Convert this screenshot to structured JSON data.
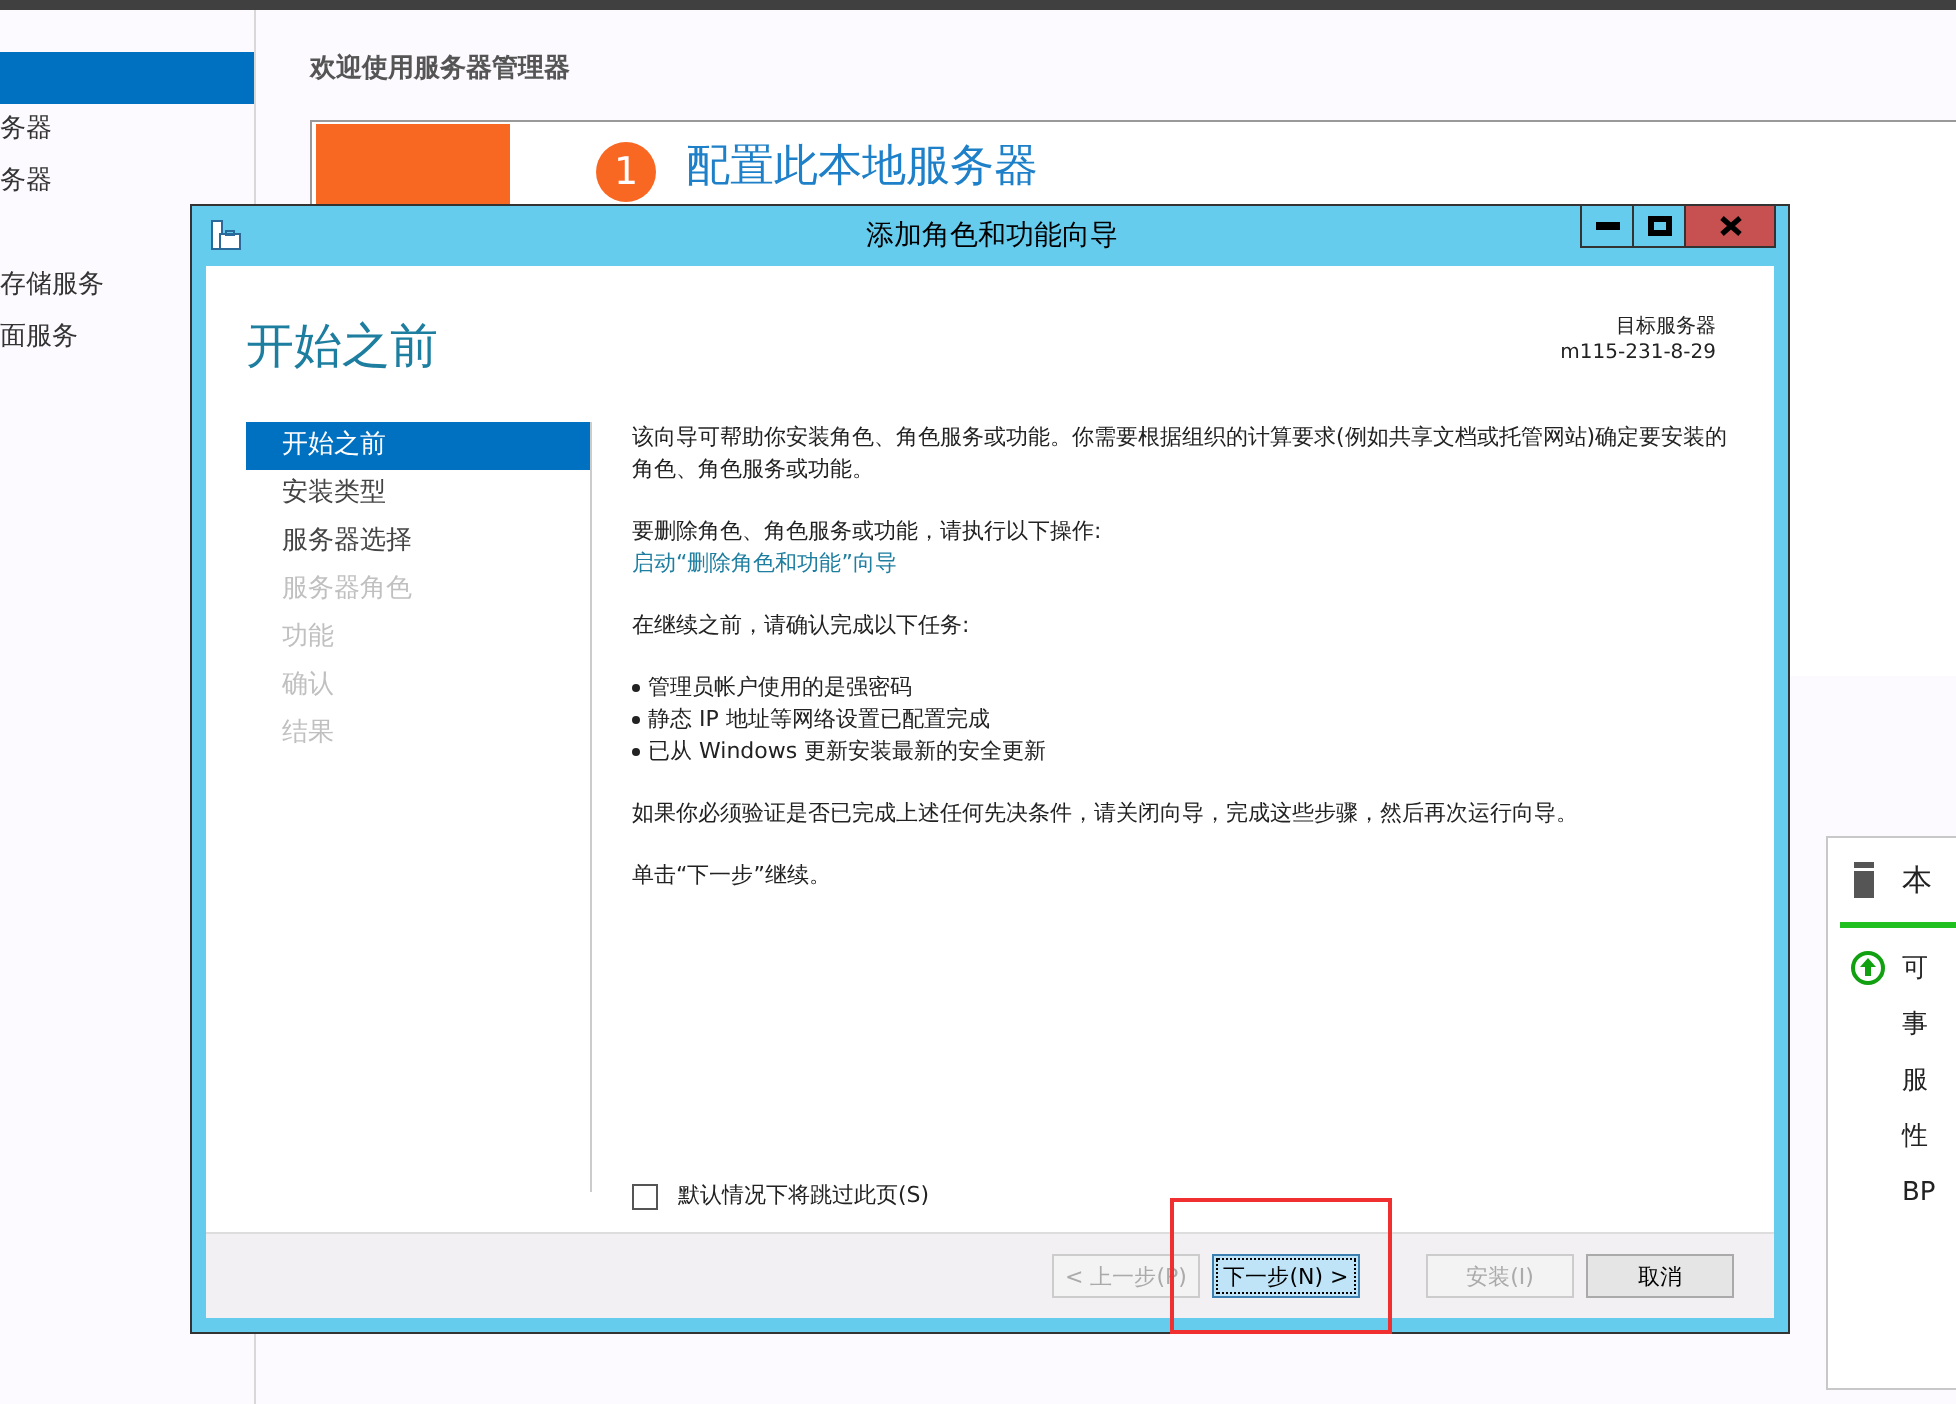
{
  "background": {
    "sidebar": {
      "items": [
        {
          "selected": true
        },
        {
          "label": "务器",
          "selected": false
        },
        {
          "label": "务器",
          "selected": false
        },
        {
          "label": "存储服务",
          "selected": false
        },
        {
          "label": "面服务",
          "selected": false
        }
      ]
    },
    "heading": "欢迎使用服务器管理器",
    "quick_start": {
      "step": "1",
      "title": "配置此本地服务器"
    },
    "tile": {
      "title": "本",
      "rows": [
        {
          "label": "可",
          "kind": "status"
        },
        {
          "label": "事",
          "kind": "plain"
        },
        {
          "label": "服",
          "kind": "plain"
        },
        {
          "label": "性",
          "kind": "plain"
        },
        {
          "label": "BP",
          "kind": "plain"
        }
      ]
    }
  },
  "dialog": {
    "title": "添加角色和功能向导",
    "page_title": "开始之前",
    "target_label": "目标服务器",
    "target_server": "m115-231-8-29",
    "nav": [
      {
        "label": "开始之前",
        "selected": true,
        "disabled": false
      },
      {
        "label": "安装类型",
        "selected": false,
        "disabled": false
      },
      {
        "label": "服务器选择",
        "selected": false,
        "disabled": false
      },
      {
        "label": "服务器角色",
        "selected": false,
        "disabled": true
      },
      {
        "label": "功能",
        "selected": false,
        "disabled": true
      },
      {
        "label": "确认",
        "selected": false,
        "disabled": true
      },
      {
        "label": "结果",
        "selected": false,
        "disabled": true
      }
    ],
    "content": [
      {
        "kind": "paragraph",
        "text": "该向导可帮助你安装角色、角色服务或功能。你需要根据组织的计算要求(例如共享文档或托管网站)确定要安装的角色、角色服务或功能。"
      },
      {
        "kind": "paragraph",
        "text": "要删除角色、角色服务或功能，请执行以下操作:",
        "link": "启动“删除角色和功能”向导"
      },
      {
        "kind": "paragraph",
        "text": "在继续之前，请确认完成以下任务:"
      },
      {
        "kind": "bullets",
        "items": [
          "管理员帐户使用的是强密码",
          "静态 IP 地址等网络设置已配置完成",
          "已从 Windows 更新安装最新的安全更新"
        ]
      },
      {
        "kind": "paragraph",
        "text": "如果你必须验证是否已完成上述任何先决条件，请关闭向导，完成这些步骤，然后再次运行向导。"
      },
      {
        "kind": "paragraph",
        "text": "单击“下一步”继续。"
      }
    ],
    "skip_checkbox": {
      "label": "默认情况下将跳过此页(S)",
      "checked": false
    },
    "buttons": [
      {
        "label": "< 上一步(P)",
        "disabled": true,
        "focused": false
      },
      {
        "label": "下一步(N) >",
        "disabled": false,
        "focused": true
      },
      {
        "label": "安装(I)",
        "disabled": true,
        "focused": false
      },
      {
        "label": "取消",
        "disabled": false,
        "focused": false
      }
    ]
  }
}
